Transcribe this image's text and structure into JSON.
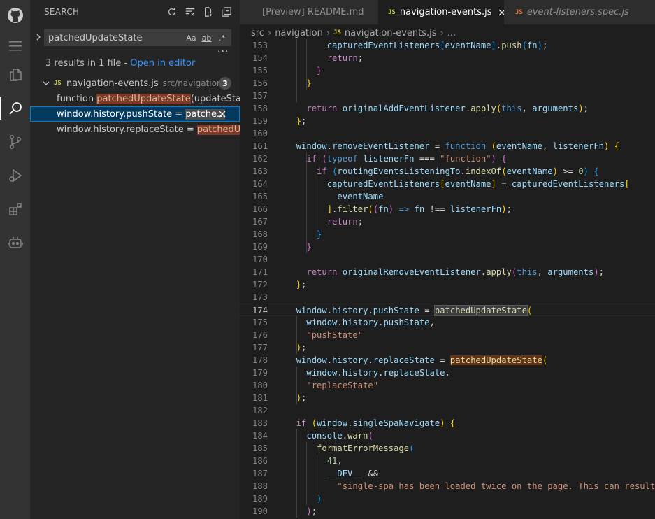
{
  "sidebar": {
    "title": "SEARCH",
    "search_value": "patchedUpdateState",
    "options": [
      "Aa",
      "ab",
      ".*"
    ],
    "results_message": "3 results in 1 file - ",
    "open_in_editor": "Open in editor",
    "file": {
      "name": "navigation-events.js",
      "path": "src/navigation",
      "count": "3",
      "badge": "JS"
    },
    "matches": [
      {
        "pre": "function ",
        "hl": "patchedUpdateState",
        "post": "(updateStat..."
      },
      {
        "pre": "window.history.pushState = ",
        "hl": "patche...",
        "post": ""
      },
      {
        "pre": "window.history.replaceState = ",
        "hl": "patchedU...",
        "post": ""
      }
    ]
  },
  "tabs": [
    {
      "label": "[Preview] README.md",
      "badge": ""
    },
    {
      "label": "navigation-events.js",
      "badge": "JS"
    },
    {
      "label": "event-listeners.spec.js",
      "badge": "JS"
    }
  ],
  "breadcrumb": {
    "seg1": "src",
    "seg2": "navigation",
    "badge": "JS",
    "file": "navigation-events.js",
    "more": "..."
  },
  "active_line": "174",
  "code": [
    {
      "n": "153",
      "t": "        capturedEventListeners[eventName].push(fn);"
    },
    {
      "n": "154",
      "t": "        return;"
    },
    {
      "n": "155",
      "t": "      }"
    },
    {
      "n": "156",
      "t": "    }"
    },
    {
      "n": "157",
      "t": ""
    },
    {
      "n": "158",
      "t": "    return originalAddEventListener.apply(this, arguments);"
    },
    {
      "n": "159",
      "t": "  };"
    },
    {
      "n": "160",
      "t": ""
    },
    {
      "n": "161",
      "t": "  window.removeEventListener = function (eventName, listenerFn) {"
    },
    {
      "n": "162",
      "t": "    if (typeof listenerFn === \"function\") {"
    },
    {
      "n": "163",
      "t": "      if (routingEventsListeningTo.indexOf(eventName) >= 0) {"
    },
    {
      "n": "164",
      "t": "        capturedEventListeners[eventName] = capturedEventListeners["
    },
    {
      "n": "165",
      "t": "          eventName"
    },
    {
      "n": "166",
      "t": "        ].filter((fn) => fn !== listenerFn);"
    },
    {
      "n": "167",
      "t": "        return;"
    },
    {
      "n": "168",
      "t": "      }"
    },
    {
      "n": "169",
      "t": "    }"
    },
    {
      "n": "170",
      "t": ""
    },
    {
      "n": "171",
      "t": "    return originalRemoveEventListener.apply(this, arguments);"
    },
    {
      "n": "172",
      "t": "  };"
    },
    {
      "n": "173",
      "t": ""
    },
    {
      "n": "174",
      "t": "  window.history.pushState = patchedUpdateState("
    },
    {
      "n": "175",
      "t": "    window.history.pushState,"
    },
    {
      "n": "176",
      "t": "    \"pushState\""
    },
    {
      "n": "177",
      "t": "  );"
    },
    {
      "n": "178",
      "t": "  window.history.replaceState = patchedUpdateState("
    },
    {
      "n": "179",
      "t": "    window.history.replaceState,"
    },
    {
      "n": "180",
      "t": "    \"replaceState\""
    },
    {
      "n": "181",
      "t": "  );"
    },
    {
      "n": "182",
      "t": ""
    },
    {
      "n": "183",
      "t": "  if (window.singleSpaNavigate) {"
    },
    {
      "n": "184",
      "t": "    console.warn("
    },
    {
      "n": "185",
      "t": "      formatErrorMessage("
    },
    {
      "n": "186",
      "t": "        41,"
    },
    {
      "n": "187",
      "t": "        __DEV__ &&"
    },
    {
      "n": "188",
      "t": "          \"single-spa has been loaded twice on the page. This can result"
    },
    {
      "n": "189",
      "t": "      )"
    },
    {
      "n": "190",
      "t": "    );"
    }
  ],
  "colors": {
    "accent": "#007fd4",
    "match_highlight": "#623315",
    "link": "#3794ff",
    "js_badge": "#cbcb41"
  },
  "icons": {
    "activity": [
      "github-icon",
      "menu-icon",
      "explorer-icon",
      "search-icon",
      "source-control-icon",
      "run-debug-icon",
      "extensions-icon",
      "copilot-icon"
    ],
    "search_actions": [
      "refresh-icon",
      "clear-results-icon",
      "new-search-editor-icon",
      "collapse-all-icon"
    ]
  }
}
